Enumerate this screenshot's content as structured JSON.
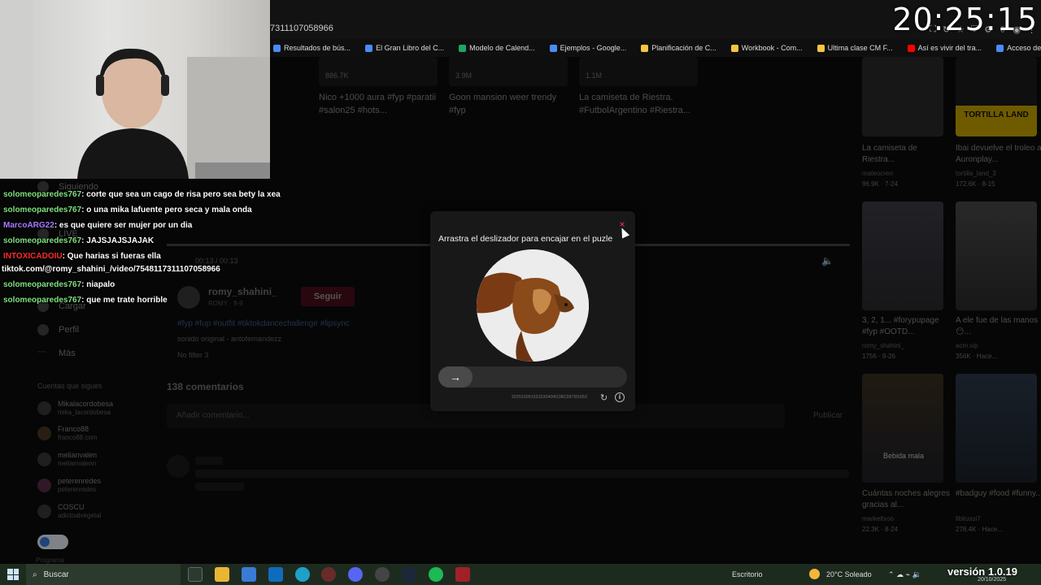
{
  "clock": "20:25:15",
  "url_fragment": "7311107058966",
  "bookmarks": [
    {
      "label": "Resultados de bús...",
      "color": "#4a8bf5"
    },
    {
      "label": "El Gran Libro del C...",
      "color": "#4a8bf5"
    },
    {
      "label": "Modelo de Calend...",
      "color": "#1fa463"
    },
    {
      "label": "Ejemplos - Google...",
      "color": "#4a8bf5"
    },
    {
      "label": "Planificación de C...",
      "color": "#f6c343"
    },
    {
      "label": "Workbook - Com...",
      "color": "#f6c343"
    },
    {
      "label": "Ultima clase CM F...",
      "color": "#f6c343"
    },
    {
      "label": "Así es vivir del tra...",
      "color": "#ff0000"
    },
    {
      "label": "Acceso denegado",
      "color": "#4a8bf5"
    }
  ],
  "top_videos": [
    {
      "count": "886.7K",
      "text": "Nico +1000 aura #fyp #paratii #salon25 #hots..."
    },
    {
      "count": "3.9M",
      "text": "Goon mansion weer trendy #fyp"
    },
    {
      "count": "1.1M",
      "text": "La camiseta de Riestra. #FutbolArgentino #Riestra..."
    }
  ],
  "nav": {
    "siguiendo": "Siguiendo",
    "live": "LIVE",
    "cargar": "Cargar",
    "perfil": "Perfil",
    "mas": "Más"
  },
  "following": {
    "heading": "Cuentas que sigues",
    "accounts": [
      {
        "name": "Mikalacordobesa",
        "handle": "mika_lacordobesa"
      },
      {
        "name": "Franco88",
        "handle": "franco88.com"
      },
      {
        "name": "melianvalen",
        "handle": "melianvalenn"
      },
      {
        "name": "peterenredes",
        "handle": "peterenredes"
      },
      {
        "name": "COSCU",
        "handle": "adictoalvegetal"
      }
    ],
    "more": "Programa"
  },
  "player": {
    "time": "00:13 / 00:13",
    "author": "romy_shahini_",
    "author_sub": "ROMY · 9-9",
    "follow_label": "Seguir",
    "tags": "#fyp #fup #outfit #tiktokdancechallenge #lipsync",
    "sound": "sonido original - antofernandezz",
    "filter": "No filter 3",
    "comments_count": "138 comentarios",
    "comment_placeholder": "Añadir comentario...",
    "publish": "Publicar"
  },
  "right_videos": [
    {
      "title": "La camiseta de Riestra...",
      "author": "mateocrerr",
      "stats": "96.9K · 7-24",
      "thumb_text": ""
    },
    {
      "title": "Ibai devuelve el troleo a Auronplay...",
      "author": "tortilla_land_3",
      "stats": "172.6K · 8-15",
      "thumb_text": "TORTILLA LAND"
    },
    {
      "title": "3, 2, 1... #forypupage #fyp #OOTD...",
      "author": "romy_shahini_",
      "stats": "1756 · 9-26",
      "thumb_text": ""
    },
    {
      "title": "A ele fue de las manos 😶...",
      "author": "acm.vip",
      "stats": "356K · Hace...",
      "thumb_text": ""
    },
    {
      "title": "Cuántas noches alegres gracias al...",
      "author": "markeltxoo",
      "stats": "22.3K · 8-24",
      "thumb_text": "Bebida mala"
    },
    {
      "title": "#badguy #food #funny...",
      "author": "libitussi7",
      "stats": "278.4K · Hace...",
      "thumb_text": ""
    }
  ],
  "chat": [
    {
      "user": "solomeoparedes767",
      "user_color": "#7fe07f",
      "text": ": corte que sea un cago de risa pero sea bety la xea"
    },
    {
      "user": "solomeoparedes767",
      "user_color": "#7fe07f",
      "text": ": o una mika lafuente pero seca y mala onda"
    },
    {
      "user": "MarcoARG22",
      "user_color": "#a779ff",
      "text": ": es que quiere ser mujer por un dia"
    },
    {
      "user": "solomeoparedes767",
      "user_color": "#7fe07f",
      "text": ": JAJSJAJSJAJAK"
    },
    {
      "user": "INTOXICADOIU",
      "user_color": "#ff2b2b",
      "text": ": Que harias si fueras ella"
    },
    {
      "user": "",
      "user_color": "#ffffff",
      "text": "tiktok.com/@romy_shahini_/video/7548117311107058966"
    },
    {
      "user": "solomeoparedes767",
      "user_color": "#7fe07f",
      "text": ": niapalo"
    },
    {
      "user": "solomeoparedes767",
      "user_color": "#7fe07f",
      "text": ": que me trate horrible"
    }
  ],
  "captcha": {
    "title": "Arrastra el deslizador para encajar en el puzle",
    "close": "×",
    "slider_arrow": "→",
    "id_code": "20251009153110040f4238C0975f1653",
    "info": "i"
  },
  "taskbar": {
    "search": "Buscar",
    "desktop": "Escritorio",
    "weather": "20°C  Soleado",
    "version": "versión 1.0.19",
    "date": "20/10/2025"
  }
}
